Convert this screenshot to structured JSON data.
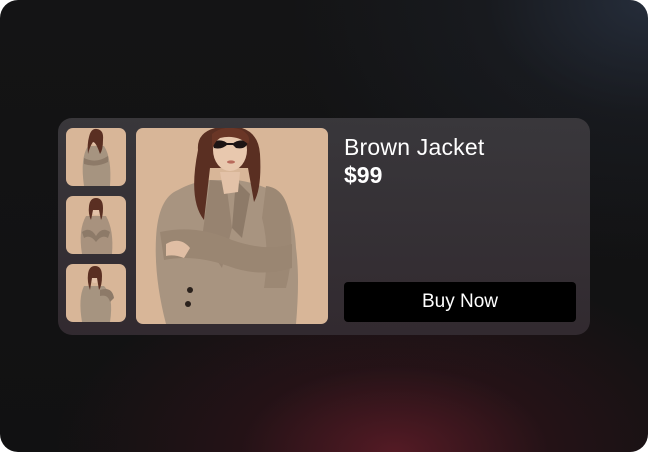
{
  "product": {
    "title": "Brown Jacket",
    "price": "$99",
    "buy_label": "Buy Now",
    "thumbnails": [
      "thumbnail-1",
      "thumbnail-2",
      "thumbnail-3"
    ],
    "selected_image": "main-product-image"
  },
  "colors": {
    "photo_background": "#d8b698",
    "jacket": "#a89480",
    "hair": "#5a2f22",
    "button": "#000000",
    "button_text": "#ffffff"
  }
}
